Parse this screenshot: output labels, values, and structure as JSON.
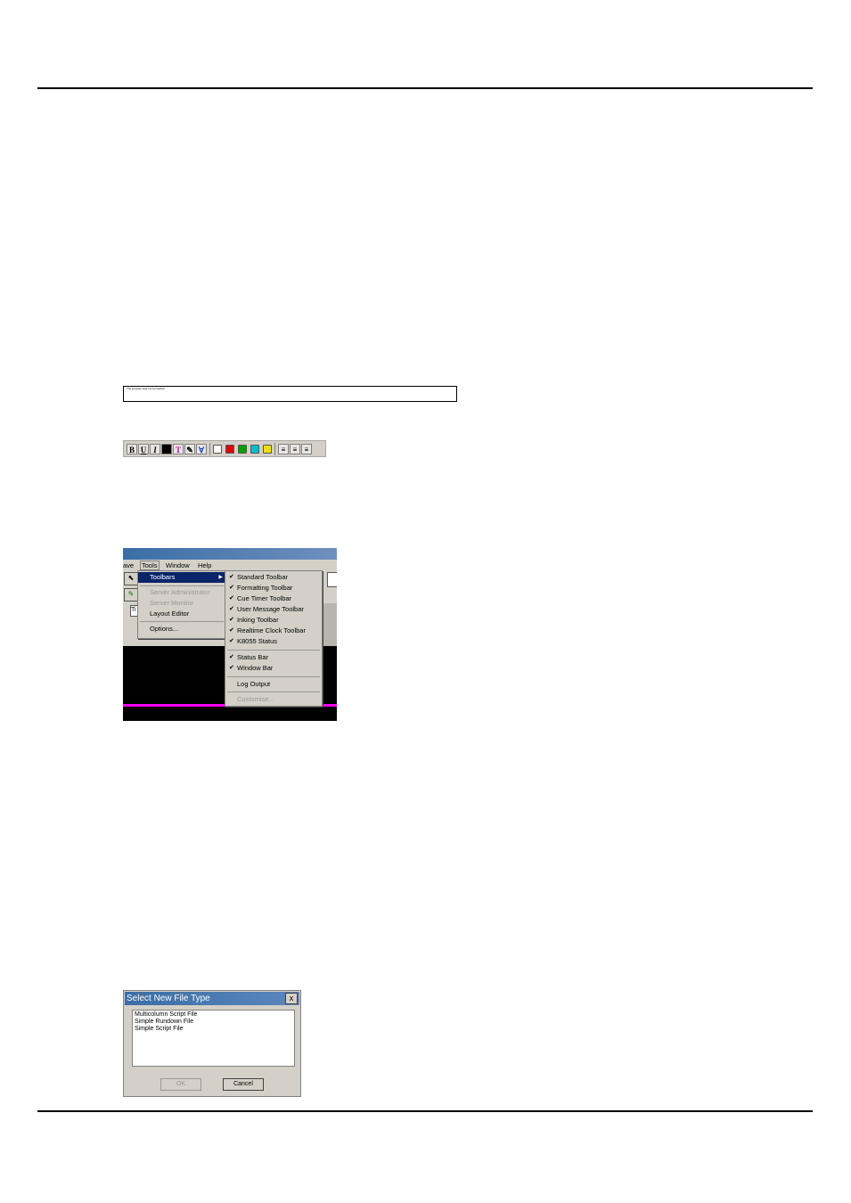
{
  "status_strip": {
    "text": "The program was not be loaded"
  },
  "formatting_toolbar": {
    "bold": "B",
    "underline": "U",
    "italic": "I",
    "colors": [
      "#ffffff",
      "#e00000",
      "#00a000",
      "#00c0d0",
      "#f0e000"
    ]
  },
  "tools_screenshot": {
    "menubar": {
      "save_partial": "ave",
      "tools": "Tools",
      "window": "Window",
      "help": "Help"
    },
    "tools_menu": {
      "toolbars": "Toolbars",
      "server_admin": "Server Administrator",
      "server_monitor": "Server Monitor",
      "layout_editor": "Layout Editor",
      "options": "Options..."
    },
    "toolbars_submenu": {
      "items": [
        "Standard Toolbar",
        "Formatting Toolbar",
        "Cue Timer Toolbar",
        "User Message Toolbar",
        "Inking Toolbar",
        "Realtime Clock Toolbar",
        "K8055 Status"
      ],
      "items2": [
        "Status Bar",
        "Window Bar"
      ],
      "log_output": "Log Output",
      "customise": "Customise..."
    },
    "field_label": "Ti"
  },
  "dialog": {
    "title": "Select New File Type",
    "close": "x",
    "options": [
      "Multicolumn Script File",
      "Simple Rundown File",
      "Simple Script File"
    ],
    "ok": "OK",
    "cancel": "Cancel"
  }
}
